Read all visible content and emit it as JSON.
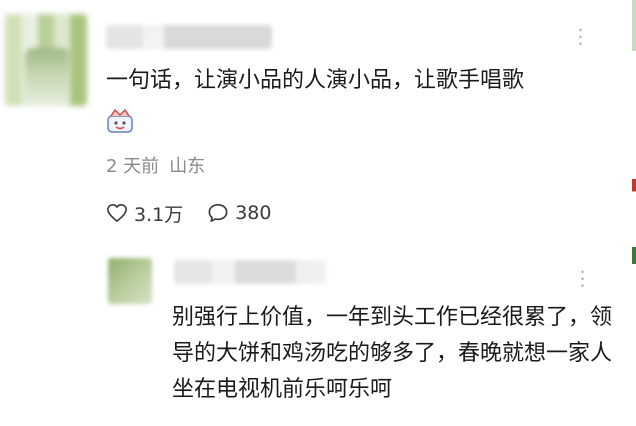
{
  "comment": {
    "text": "一句话，让演小品的人演小品，让歌手唱歌",
    "time": "2 天前",
    "location": "山东",
    "likes": "3.1万",
    "replies": "380",
    "more_icon": "more-dots-icon",
    "emoji_icon": "face-emoji-icon"
  },
  "reply": {
    "text": "别强行上价值，一年到头工作已经很累了，领导的大饼和鸡汤吃的够多了，春晚就想一家人坐在电视机前乐呵乐呵",
    "more_icon": "more-dots-icon"
  },
  "colors": {
    "text": "#1a1a1a",
    "meta": "#8a8a8a",
    "icon": "#3a3a3a"
  }
}
